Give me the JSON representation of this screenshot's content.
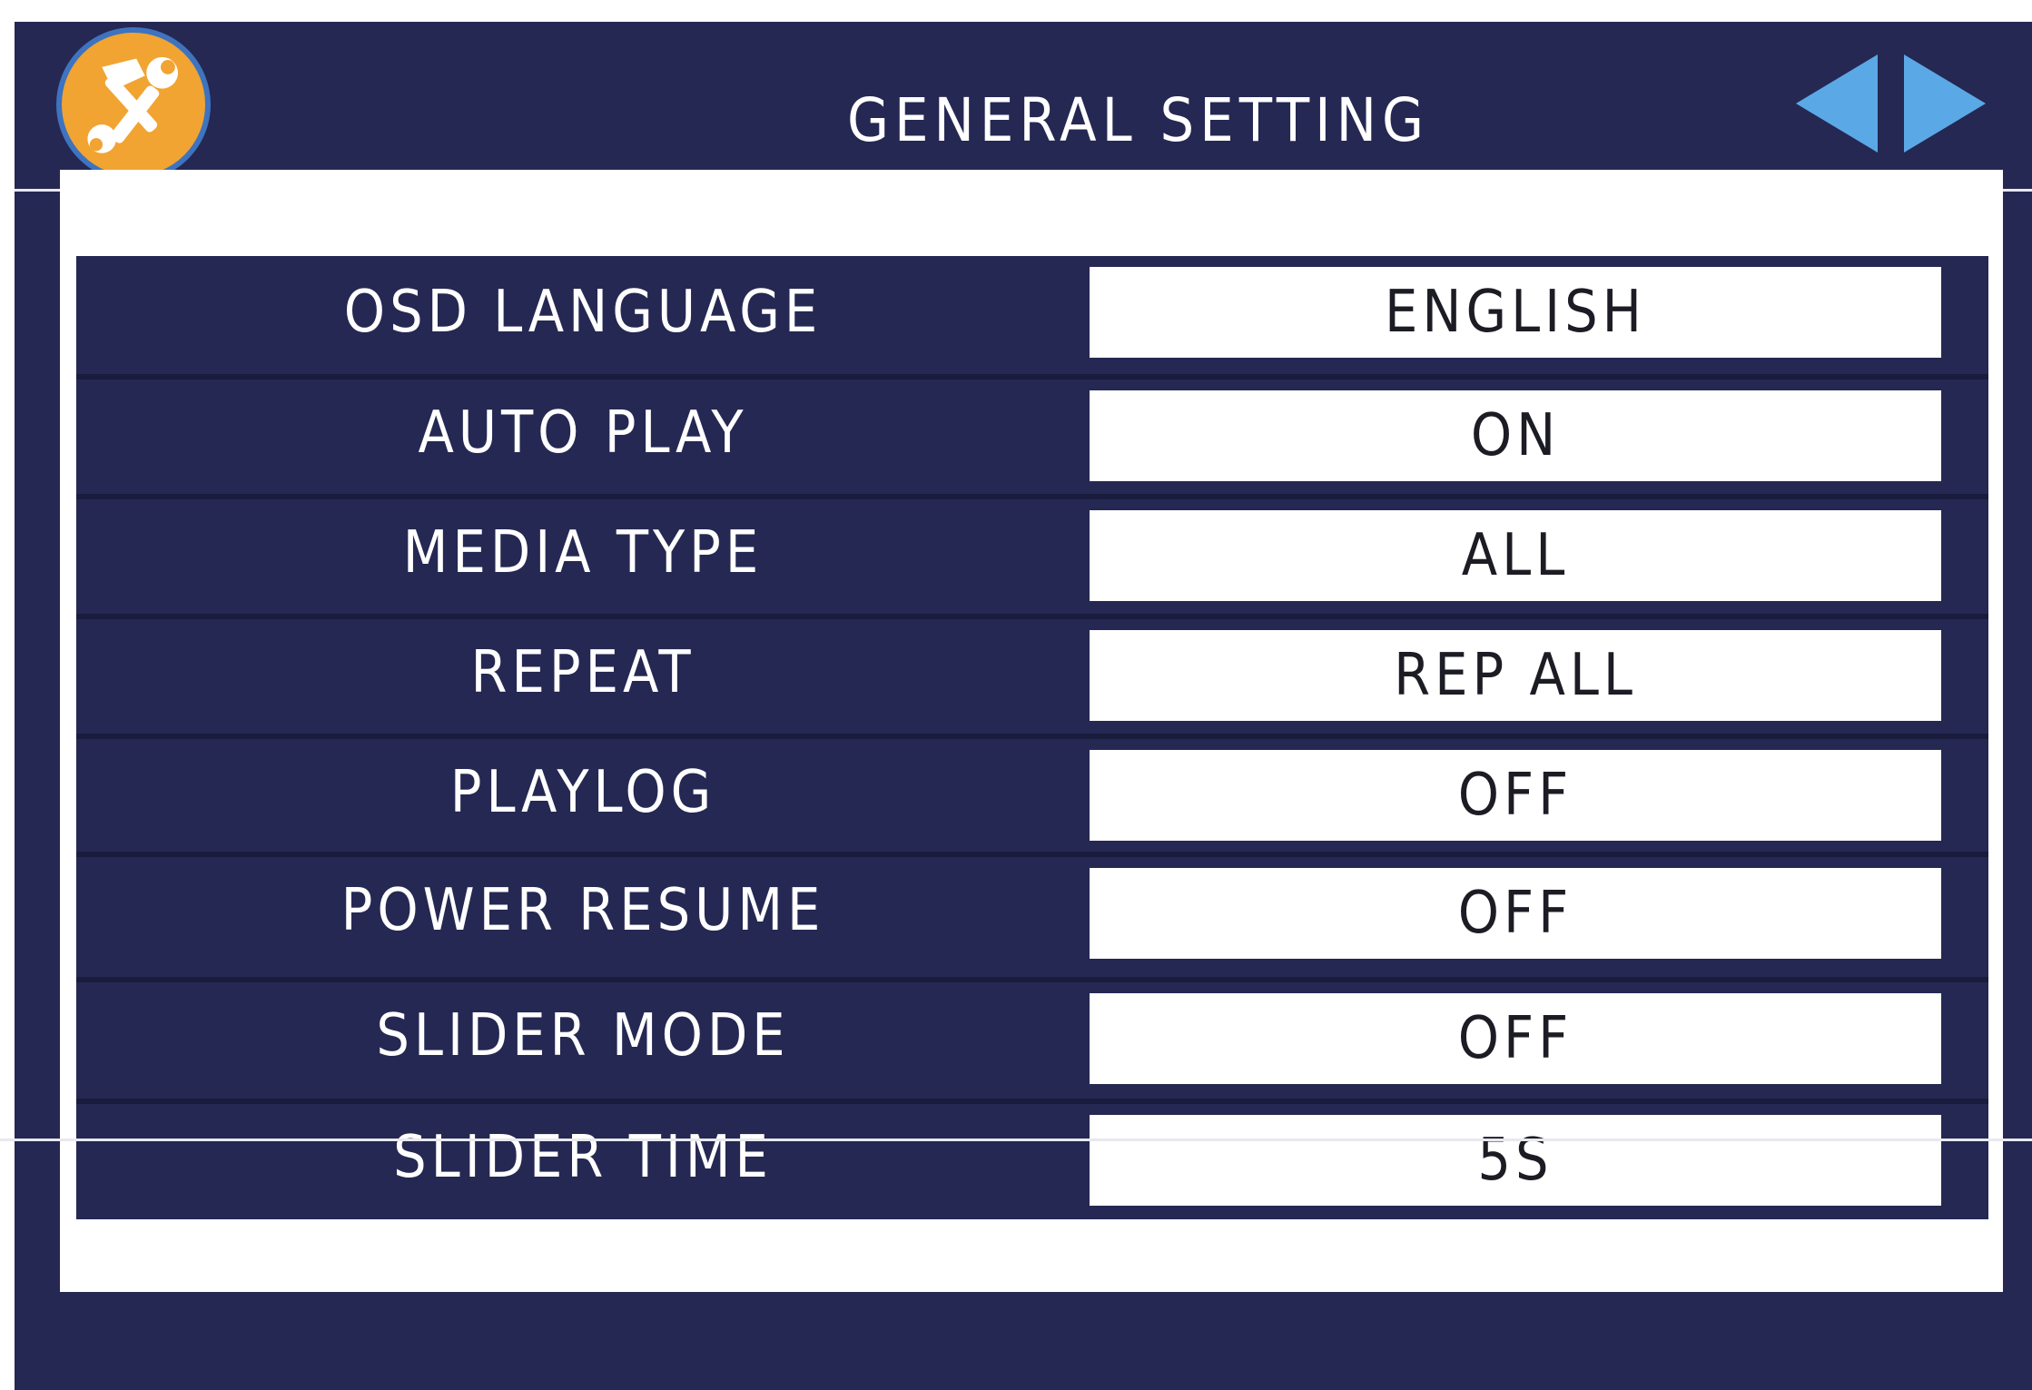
{
  "header": {
    "title": "GENERAL SETTING",
    "logo_icon": "tools-icon",
    "prev_icon": "arrow-left-icon",
    "next_icon": "arrow-right-icon"
  },
  "colors": {
    "background": "#252852",
    "panel": "#ffffff",
    "logo_fill": "#f1a431",
    "logo_ring": "#3e73c0",
    "arrow": "#5aa9e6"
  },
  "settings": [
    {
      "label": "OSD LANGUAGE",
      "value": "ENGLISH"
    },
    {
      "label": "AUTO PLAY",
      "value": "ON"
    },
    {
      "label": "MEDIA TYPE",
      "value": "ALL"
    },
    {
      "label": "REPEAT",
      "value": "REP ALL"
    },
    {
      "label": "PLAYLOG",
      "value": "OFF"
    },
    {
      "label": "POWER RESUME",
      "value": "OFF"
    },
    {
      "label": "SLIDER MODE",
      "value": "OFF"
    },
    {
      "label": "SLIDER TIME",
      "value": "5S"
    }
  ]
}
